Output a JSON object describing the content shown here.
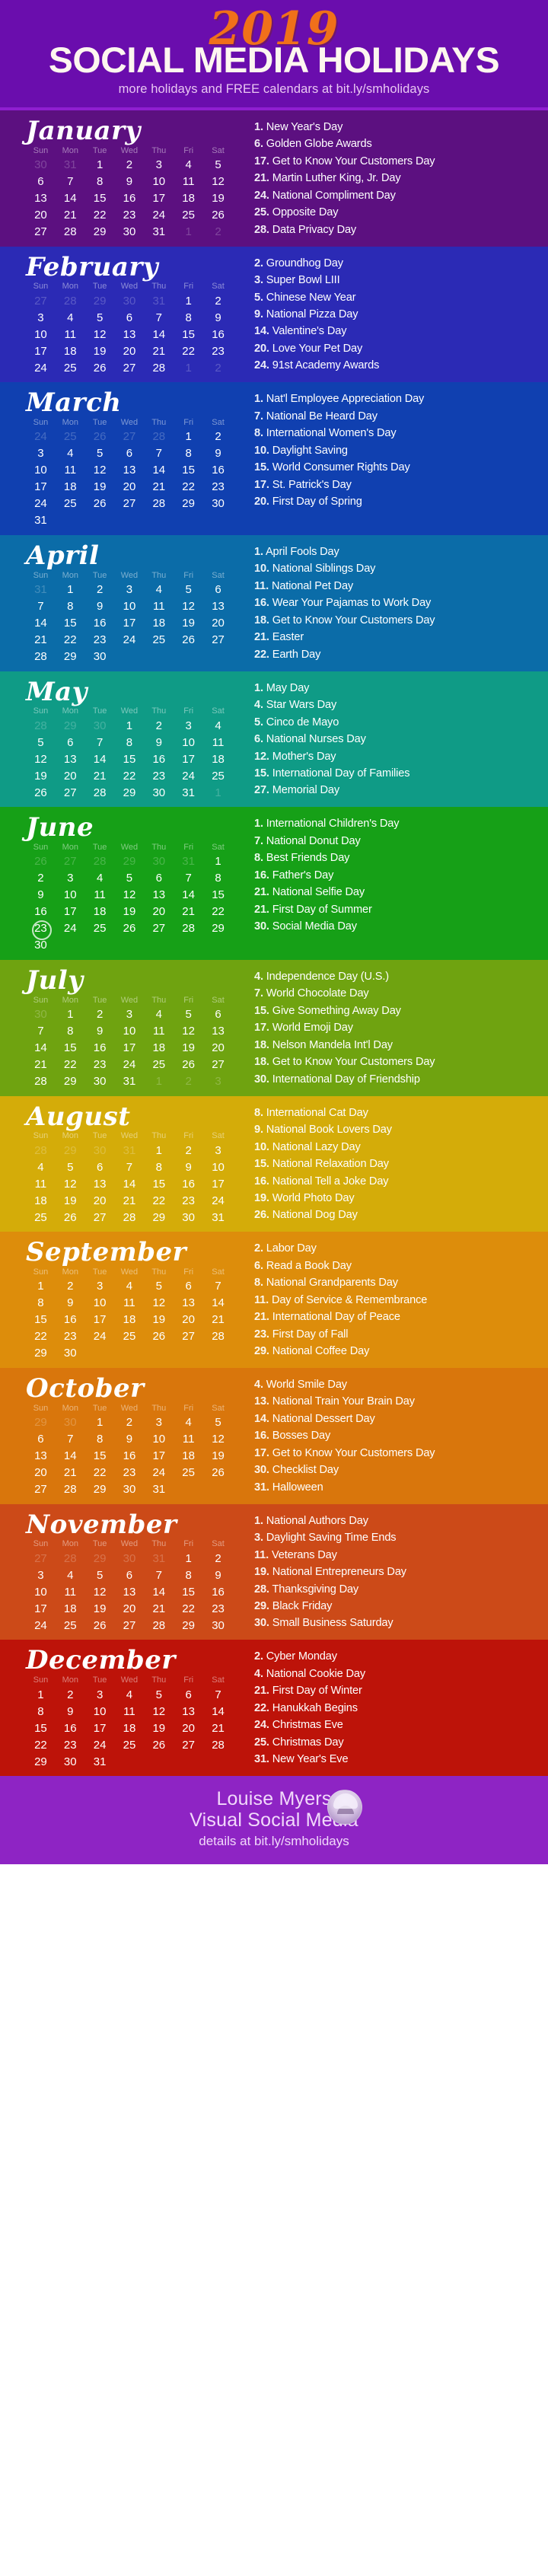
{
  "header": {
    "year": "2019",
    "title": "SOCIAL MEDIA HOLIDAYS",
    "subtitle": "more holidays and FREE calendars at bit.ly/smholidays",
    "bg_color": "#6a0dad",
    "year_color": "#f0701a"
  },
  "weekday_headers": [
    "Sun",
    "Mon",
    "Tue",
    "Wed",
    "Thu",
    "Fri",
    "Sat"
  ],
  "months": [
    {
      "name": "January",
      "bg_color": "#5c1080",
      "grid": [
        [
          "30",
          "31",
          "1",
          "2",
          "3",
          "4",
          "5"
        ],
        [
          "6",
          "7",
          "8",
          "9",
          "10",
          "11",
          "12"
        ],
        [
          "13",
          "14",
          "15",
          "16",
          "17",
          "18",
          "19"
        ],
        [
          "20",
          "21",
          "22",
          "23",
          "24",
          "25",
          "26"
        ],
        [
          "27",
          "28",
          "29",
          "30",
          "31",
          "1",
          "2"
        ]
      ],
      "out": [
        [
          0,
          0
        ],
        [
          0,
          1
        ],
        [
          4,
          5
        ],
        [
          4,
          6
        ]
      ],
      "marks": [],
      "holidays": [
        {
          "day": "1.",
          "name": "New Year's Day"
        },
        {
          "day": "6.",
          "name": "Golden Globe Awards"
        },
        {
          "day": "17.",
          "name": "Get to Know Your Customers Day"
        },
        {
          "day": "21.",
          "name": "Martin Luther King, Jr. Day"
        },
        {
          "day": "24.",
          "name": "National Compliment Day"
        },
        {
          "day": "25.",
          "name": "Opposite Day"
        },
        {
          "day": "28.",
          "name": "Data Privacy Day"
        }
      ]
    },
    {
      "name": "February",
      "bg_color": "#2b2ab5",
      "grid": [
        [
          "27",
          "28",
          "29",
          "30",
          "31",
          "1",
          "2"
        ],
        [
          "3",
          "4",
          "5",
          "6",
          "7",
          "8",
          "9"
        ],
        [
          "10",
          "11",
          "12",
          "13",
          "14",
          "15",
          "16"
        ],
        [
          "17",
          "18",
          "19",
          "20",
          "21",
          "22",
          "23"
        ],
        [
          "24",
          "25",
          "26",
          "27",
          "28",
          "1",
          "2"
        ]
      ],
      "out": [
        [
          0,
          0
        ],
        [
          0,
          1
        ],
        [
          0,
          2
        ],
        [
          0,
          3
        ],
        [
          0,
          4
        ],
        [
          4,
          5
        ],
        [
          4,
          6
        ]
      ],
      "marks": [],
      "holidays": [
        {
          "day": "2.",
          "name": "Groundhog Day"
        },
        {
          "day": "3.",
          "name": "Super Bowl LIII"
        },
        {
          "day": "5.",
          "name": "Chinese New Year"
        },
        {
          "day": "9.",
          "name": "National Pizza Day"
        },
        {
          "day": "14.",
          "name": "Valentine's Day"
        },
        {
          "day": "20.",
          "name": "Love Your Pet Day"
        },
        {
          "day": "24.",
          "name": "91st Academy Awards"
        }
      ]
    },
    {
      "name": "March",
      "bg_color": "#1040b0",
      "grid": [
        [
          "24",
          "25",
          "26",
          "27",
          "28",
          "1",
          "2"
        ],
        [
          "3",
          "4",
          "5",
          "6",
          "7",
          "8",
          "9"
        ],
        [
          "10",
          "11",
          "12",
          "13",
          "14",
          "15",
          "16"
        ],
        [
          "17",
          "18",
          "19",
          "20",
          "21",
          "22",
          "23"
        ],
        [
          "24",
          "25",
          "26",
          "27",
          "28",
          "29",
          "30"
        ],
        [
          "31",
          "",
          "",
          "",
          "",
          "",
          ""
        ]
      ],
      "out": [
        [
          0,
          0
        ],
        [
          0,
          1
        ],
        [
          0,
          2
        ],
        [
          0,
          3
        ],
        [
          0,
          4
        ]
      ],
      "marks": [],
      "holidays": [
        {
          "day": "1.",
          "name": "Nat'l Employee Appreciation Day"
        },
        {
          "day": "7.",
          "name": "National Be Heard Day"
        },
        {
          "day": "8.",
          "name": "International Women's Day"
        },
        {
          "day": "10.",
          "name": "Daylight Saving"
        },
        {
          "day": "15.",
          "name": "World Consumer Rights Day"
        },
        {
          "day": "17.",
          "name": "St. Patrick's Day"
        },
        {
          "day": "20.",
          "name": "First Day of Spring"
        }
      ]
    },
    {
      "name": "April",
      "bg_color": "#0b6ca8",
      "grid": [
        [
          "31",
          "1",
          "2",
          "3",
          "4",
          "5",
          "6"
        ],
        [
          "7",
          "8",
          "9",
          "10",
          "11",
          "12",
          "13"
        ],
        [
          "14",
          "15",
          "16",
          "17",
          "18",
          "19",
          "20"
        ],
        [
          "21",
          "22",
          "23",
          "24",
          "25",
          "26",
          "27"
        ],
        [
          "28",
          "29",
          "30",
          "",
          "",
          "",
          ""
        ]
      ],
      "out": [
        [
          0,
          0
        ]
      ],
      "marks": [],
      "holidays": [
        {
          "day": "1.",
          "name": "April Fools Day"
        },
        {
          "day": "10.",
          "name": "National Siblings Day"
        },
        {
          "day": "11.",
          "name": "National Pet Day"
        },
        {
          "day": "16.",
          "name": "Wear Your Pajamas to Work Day"
        },
        {
          "day": "18.",
          "name": "Get to Know Your Customers Day"
        },
        {
          "day": "21.",
          "name": "Easter"
        },
        {
          "day": "22.",
          "name": "Earth Day"
        }
      ]
    },
    {
      "name": "May",
      "bg_color": "#0f9b86",
      "grid": [
        [
          "28",
          "29",
          "30",
          "1",
          "2",
          "3",
          "4"
        ],
        [
          "5",
          "6",
          "7",
          "8",
          "9",
          "10",
          "11"
        ],
        [
          "12",
          "13",
          "14",
          "15",
          "16",
          "17",
          "18"
        ],
        [
          "19",
          "20",
          "21",
          "22",
          "23",
          "24",
          "25"
        ],
        [
          "26",
          "27",
          "28",
          "29",
          "30",
          "31",
          "1"
        ]
      ],
      "out": [
        [
          0,
          0
        ],
        [
          0,
          1
        ],
        [
          0,
          2
        ],
        [
          4,
          6
        ]
      ],
      "marks": [],
      "holidays": [
        {
          "day": "1.",
          "name": "May Day"
        },
        {
          "day": "4.",
          "name": "Star Wars Day"
        },
        {
          "day": "5.",
          "name": "Cinco de Mayo"
        },
        {
          "day": "6.",
          "name": "National Nurses Day"
        },
        {
          "day": "12.",
          "name": "Mother's Day"
        },
        {
          "day": "15.",
          "name": "International Day of Families"
        },
        {
          "day": "27.",
          "name": "Memorial Day"
        }
      ]
    },
    {
      "name": "June",
      "bg_color": "#16a017",
      "grid": [
        [
          "26",
          "27",
          "28",
          "29",
          "30",
          "31",
          "1"
        ],
        [
          "2",
          "3",
          "4",
          "5",
          "6",
          "7",
          "8"
        ],
        [
          "9",
          "10",
          "11",
          "12",
          "13",
          "14",
          "15"
        ],
        [
          "16",
          "17",
          "18",
          "19",
          "20",
          "21",
          "22"
        ],
        [
          "23",
          "24",
          "25",
          "26",
          "27",
          "28",
          "29"
        ],
        [
          "30",
          "",
          "",
          "",
          "",
          "",
          ""
        ]
      ],
      "out": [
        [
          0,
          0
        ],
        [
          0,
          1
        ],
        [
          0,
          2
        ],
        [
          0,
          3
        ],
        [
          0,
          4
        ],
        [
          0,
          5
        ]
      ],
      "marks": [
        [
          4,
          0
        ]
      ],
      "holidays": [
        {
          "day": "1.",
          "name": "International Children's Day"
        },
        {
          "day": "7.",
          "name": "National Donut Day"
        },
        {
          "day": "8.",
          "name": "Best Friends Day"
        },
        {
          "day": "16.",
          "name": "Father's Day"
        },
        {
          "day": "21.",
          "name": "National Selfie Day"
        },
        {
          "day": "21.",
          "name": "First Day of Summer"
        },
        {
          "day": "30.",
          "name": "Social Media Day"
        }
      ]
    },
    {
      "name": "July",
      "bg_color": "#6fa310",
      "grid": [
        [
          "30",
          "1",
          "2",
          "3",
          "4",
          "5",
          "6"
        ],
        [
          "7",
          "8",
          "9",
          "10",
          "11",
          "12",
          "13"
        ],
        [
          "14",
          "15",
          "16",
          "17",
          "18",
          "19",
          "20"
        ],
        [
          "21",
          "22",
          "23",
          "24",
          "25",
          "26",
          "27"
        ],
        [
          "28",
          "29",
          "30",
          "31",
          "1",
          "2",
          "3"
        ]
      ],
      "out": [
        [
          0,
          0
        ],
        [
          4,
          4
        ],
        [
          4,
          5
        ],
        [
          4,
          6
        ]
      ],
      "marks": [],
      "holidays": [
        {
          "day": "4.",
          "name": "Independence Day (U.S.)"
        },
        {
          "day": "7.",
          "name": "World Chocolate Day"
        },
        {
          "day": "15.",
          "name": "Give Something Away Day"
        },
        {
          "day": "17.",
          "name": "World Emoji Day"
        },
        {
          "day": "18.",
          "name": "Nelson Mandela Int'l Day"
        },
        {
          "day": "18.",
          "name": "Get to Know Your Customers Day"
        },
        {
          "day": "30.",
          "name": "International Day of Friendship"
        }
      ]
    },
    {
      "name": "August",
      "bg_color": "#d4ac09",
      "grid": [
        [
          "28",
          "29",
          "30",
          "31",
          "1",
          "2",
          "3"
        ],
        [
          "4",
          "5",
          "6",
          "7",
          "8",
          "9",
          "10"
        ],
        [
          "11",
          "12",
          "13",
          "14",
          "15",
          "16",
          "17"
        ],
        [
          "18",
          "19",
          "20",
          "21",
          "22",
          "23",
          "24"
        ],
        [
          "25",
          "26",
          "27",
          "28",
          "29",
          "30",
          "31"
        ]
      ],
      "out": [
        [
          0,
          0
        ],
        [
          0,
          1
        ],
        [
          0,
          2
        ],
        [
          0,
          3
        ]
      ],
      "marks": [],
      "holidays": [
        {
          "day": "8.",
          "name": "International Cat Day"
        },
        {
          "day": "9.",
          "name": "National Book Lovers Day"
        },
        {
          "day": "10.",
          "name": "National Lazy Day"
        },
        {
          "day": "15.",
          "name": "National Relaxation Day"
        },
        {
          "day": "16.",
          "name": "National Tell a Joke Day"
        },
        {
          "day": "19.",
          "name": "World Photo Day"
        },
        {
          "day": "26.",
          "name": "National Dog Day"
        }
      ]
    },
    {
      "name": "September",
      "bg_color": "#dd8d0b",
      "grid": [
        [
          "1",
          "2",
          "3",
          "4",
          "5",
          "6",
          "7"
        ],
        [
          "8",
          "9",
          "10",
          "11",
          "12",
          "13",
          "14"
        ],
        [
          "15",
          "16",
          "17",
          "18",
          "19",
          "20",
          "21"
        ],
        [
          "22",
          "23",
          "24",
          "25",
          "26",
          "27",
          "28"
        ],
        [
          "29",
          "30",
          "",
          "",
          "",
          "",
          ""
        ]
      ],
      "out": [],
      "marks": [],
      "holidays": [
        {
          "day": "2.",
          "name": "Labor Day"
        },
        {
          "day": "6.",
          "name": "Read a Book Day"
        },
        {
          "day": "8.",
          "name": "National Grandparents Day"
        },
        {
          "day": "11.",
          "name": "Day of Service & Remembrance"
        },
        {
          "day": "21.",
          "name": "International Day of Peace"
        },
        {
          "day": "23.",
          "name": "First Day of Fall"
        },
        {
          "day": "29.",
          "name": "National Coffee Day"
        }
      ]
    },
    {
      "name": "October",
      "bg_color": "#d9760c",
      "grid": [
        [
          "29",
          "30",
          "1",
          "2",
          "3",
          "4",
          "5"
        ],
        [
          "6",
          "7",
          "8",
          "9",
          "10",
          "11",
          "12"
        ],
        [
          "13",
          "14",
          "15",
          "16",
          "17",
          "18",
          "19"
        ],
        [
          "20",
          "21",
          "22",
          "23",
          "24",
          "25",
          "26"
        ],
        [
          "27",
          "28",
          "29",
          "30",
          "31",
          "",
          ""
        ]
      ],
      "out": [
        [
          0,
          0
        ],
        [
          0,
          1
        ]
      ],
      "marks": [],
      "holidays": [
        {
          "day": "4.",
          "name": "World Smile Day"
        },
        {
          "day": "13.",
          "name": "National Train Your Brain Day"
        },
        {
          "day": "14.",
          "name": "National Dessert Day"
        },
        {
          "day": "16.",
          "name": "Bosses Day"
        },
        {
          "day": "17.",
          "name": "Get to Know Your Customers Day"
        },
        {
          "day": "30.",
          "name": "Checklist Day"
        },
        {
          "day": "31.",
          "name": "Halloween"
        }
      ]
    },
    {
      "name": "November",
      "bg_color": "#cc4a18",
      "grid": [
        [
          "27",
          "28",
          "29",
          "30",
          "31",
          "1",
          "2"
        ],
        [
          "3",
          "4",
          "5",
          "6",
          "7",
          "8",
          "9"
        ],
        [
          "10",
          "11",
          "12",
          "13",
          "14",
          "15",
          "16"
        ],
        [
          "17",
          "18",
          "19",
          "20",
          "21",
          "22",
          "23"
        ],
        [
          "24",
          "25",
          "26",
          "27",
          "28",
          "29",
          "30"
        ]
      ],
      "out": [
        [
          0,
          0
        ],
        [
          0,
          1
        ],
        [
          0,
          2
        ],
        [
          0,
          3
        ],
        [
          0,
          4
        ]
      ],
      "marks": [],
      "holidays": [
        {
          "day": "1.",
          "name": "National Authors Day"
        },
        {
          "day": "3.",
          "name": "Daylight Saving Time Ends"
        },
        {
          "day": "11.",
          "name": "Veterans Day"
        },
        {
          "day": "19.",
          "name": "National Entrepreneurs Day"
        },
        {
          "day": "28.",
          "name": "Thanksgiving Day"
        },
        {
          "day": "29.",
          "name": "Black Friday"
        },
        {
          "day": "30.",
          "name": "Small Business Saturday"
        }
      ]
    },
    {
      "name": "December",
      "bg_color": "#bd1309",
      "grid": [
        [
          "1",
          "2",
          "3",
          "4",
          "5",
          "6",
          "7"
        ],
        [
          "8",
          "9",
          "10",
          "11",
          "12",
          "13",
          "14"
        ],
        [
          "15",
          "16",
          "17",
          "18",
          "19",
          "20",
          "21"
        ],
        [
          "22",
          "23",
          "24",
          "25",
          "26",
          "27",
          "28"
        ],
        [
          "29",
          "30",
          "31",
          "",
          "",
          "",
          ""
        ]
      ],
      "out": [],
      "marks": [],
      "holidays": [
        {
          "day": "2.",
          "name": "Cyber Monday"
        },
        {
          "day": "4.",
          "name": "National Cookie Day"
        },
        {
          "day": "21.",
          "name": "First Day of Winter"
        },
        {
          "day": "22.",
          "name": "Hanukkah Begins"
        },
        {
          "day": "24.",
          "name": "Christmas Eve"
        },
        {
          "day": "25.",
          "name": "Christmas Day"
        },
        {
          "day": "31.",
          "name": "New Year's Eve"
        }
      ]
    }
  ],
  "footer": {
    "name_line1": "Louise Myers",
    "name_line2": "Visual Social Media",
    "details": "details at bit.ly/smholidays",
    "bg_color": "#8e24c4"
  }
}
